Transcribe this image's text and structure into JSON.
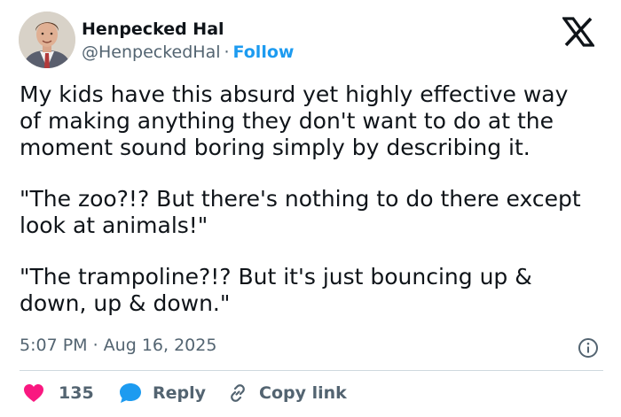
{
  "author": {
    "name": "Henpecked Hal",
    "handle": "@HenpeckedHal",
    "separator": "·",
    "follow_label": "Follow"
  },
  "tweet": {
    "paragraphs": [
      "My kids have this absurd yet highly effective way\nof making anything they don't want to do at the\nmoment sound boring simply by describing it.",
      "\"The zoo?!? But there's nothing to do there except\nlook at animals!\"",
      "\"The trampoline?!? But it's just bouncing up &\ndown, up & down.\""
    ],
    "timestamp": "5:07 PM · Aug 16, 2025"
  },
  "actions": {
    "like_count": "135",
    "reply_label": "Reply",
    "copy_link_label": "Copy link"
  },
  "icons": {
    "platform_logo": "x-logo-icon",
    "info": "info-icon",
    "like": "heart-icon",
    "reply": "reply-bubble-icon",
    "copy": "link-icon"
  },
  "colors": {
    "accent": "#1d9bf0",
    "like": "#f91880",
    "text": "#0f1419",
    "secondary": "#536471",
    "divider": "#cfd9de"
  }
}
